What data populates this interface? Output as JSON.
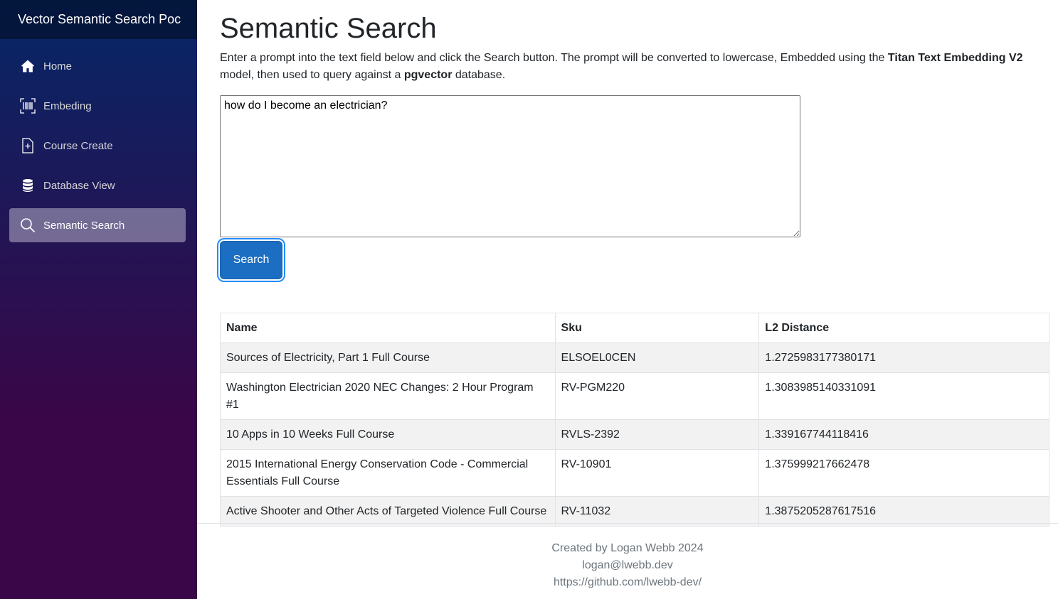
{
  "sidebar": {
    "brand": "Vector Semantic Search Poc",
    "items": [
      {
        "label": "Home",
        "icon": "home-icon"
      },
      {
        "label": "Embeding",
        "icon": "barcode-icon"
      },
      {
        "label": "Course Create",
        "icon": "file-plus-icon"
      },
      {
        "label": "Database View",
        "icon": "database-icon"
      },
      {
        "label": "Semantic Search",
        "icon": "search-icon",
        "active": true
      }
    ]
  },
  "main": {
    "title": "Semantic Search",
    "intro": {
      "part1": "Enter a prompt into the text field below and click the Search button. The prompt will be converted to lowercase, Embedded using the ",
      "bold1": "Titan Text Embedding V2",
      "part2": " model, then used to query against a ",
      "bold2": "pgvector",
      "part3": " database."
    },
    "prompt_value": "how do I become an electrician?",
    "search_label": "Search",
    "table": {
      "headers": [
        "Name",
        "Sku",
        "L2 Distance"
      ],
      "rows": [
        [
          "Sources of Electricity, Part 1 Full Course",
          "ELSOEL0CEN",
          "1.2725983177380171"
        ],
        [
          "Washington Electrician 2020 NEC Changes: 2 Hour Program #1",
          "RV-PGM220",
          "1.3083985140331091"
        ],
        [
          "10 Apps in 10 Weeks Full Course",
          "RVLS-2392",
          "1.339167744118416"
        ],
        [
          "2015 International Energy Conservation Code - Commercial Essentials Full Course",
          "RV-10901",
          "1.375999217662478"
        ],
        [
          "Active Shooter and Other Acts of Targeted Violence Full Course",
          "RV-11032",
          "1.3875205287617516"
        ]
      ]
    }
  },
  "footer": {
    "line1": "Created by Logan Webb 2024",
    "line2": "logan@lwebb.dev",
    "line3": "https://github.com/lwebb-dev/"
  },
  "colors": {
    "sidebar_top": "#052767",
    "sidebar_bottom": "#3a0647",
    "button": "#1b6ec2"
  }
}
